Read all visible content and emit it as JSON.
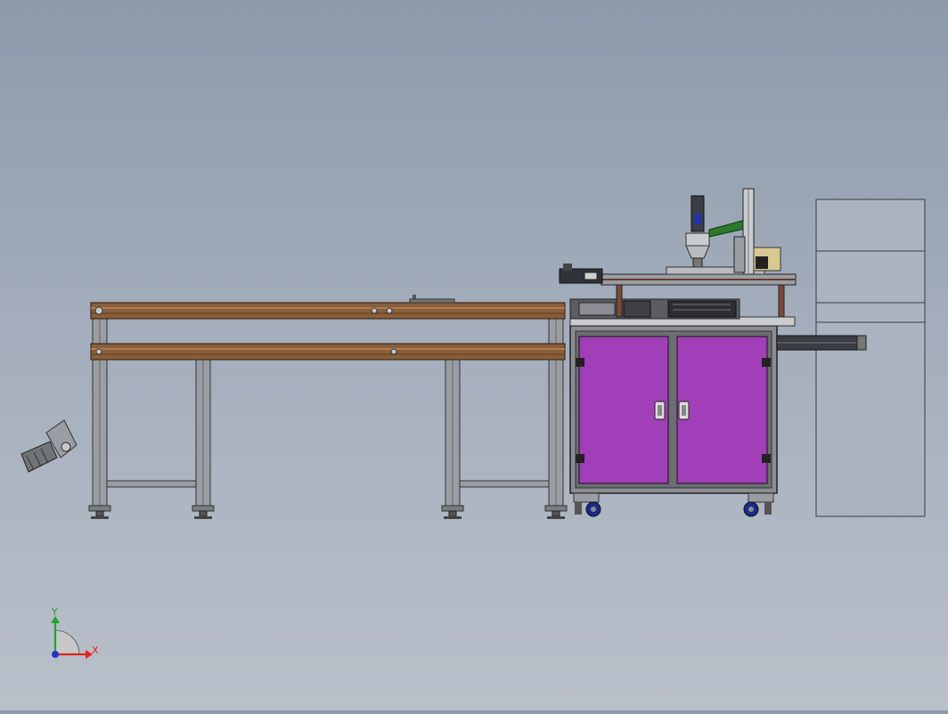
{
  "viewport": {
    "background_top": "#8d9aab",
    "background_bottom": "#b9c0ca"
  },
  "triad": {
    "x_label": "X",
    "y_label": "Y",
    "x_color": "#e0221f",
    "y_color": "#1ea330",
    "z_color": "#2233cc"
  },
  "colors": {
    "conveyor_rail": "#8a5e3a",
    "frame_aluminum": "#9a9ea4",
    "cabinet_door": "#a13fb8",
    "cabinet_frame": "#8a8d92",
    "caster": "#1a2a8a",
    "side_panel": "#aab3c0"
  },
  "icons": [
    "viewport-triad-icon",
    "motor-icon",
    "caster-icon",
    "door-handle-icon"
  ]
}
